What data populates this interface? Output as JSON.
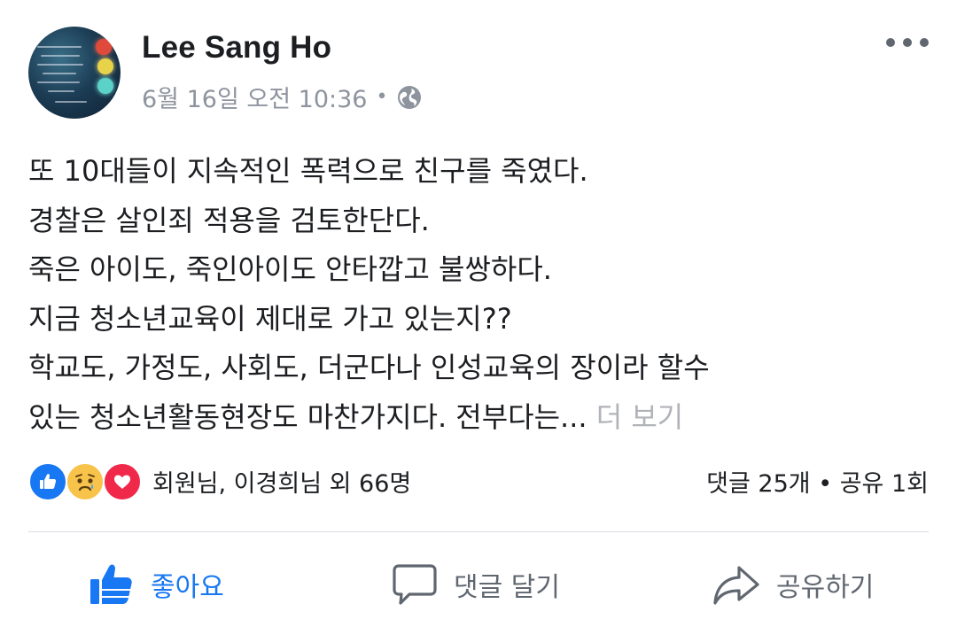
{
  "post": {
    "author": "Lee Sang Ho",
    "timestamp": "6월 16일 오전 10:36",
    "separator": "•",
    "privacy_icon": "globe-icon",
    "more_icon": "more-options-icon",
    "text_lines": [
      "또 10대들이 지속적인 폭력으로 친구를 죽였다.",
      "경찰은 살인죄 적용을 검토한단다.",
      "죽은 아이도, 죽인아이도 안타깝고 불쌍하다.",
      "지금 청소년교육이 제대로 가고 있는지??",
      "학교도, 가정도, 사회도, 더군다나 인성교육의 장이라 할수",
      "있는 청소년활동현장도 마찬가지다. 전부다는..."
    ],
    "see_more": "더 보기"
  },
  "reactions": {
    "icons": [
      "like-icon",
      "sad-icon",
      "love-icon"
    ],
    "names": "회원님, 이경희님 외 66명",
    "stats": "댓글 25개 • 공유 1회"
  },
  "actions": {
    "like": "좋아요",
    "comment": "댓글 달기",
    "share": "공유하기"
  },
  "colors": {
    "brand_blue": "#1877f2",
    "muted_text": "#8d949e",
    "see_more": "#b0b3b8",
    "action_gray": "#606770"
  }
}
